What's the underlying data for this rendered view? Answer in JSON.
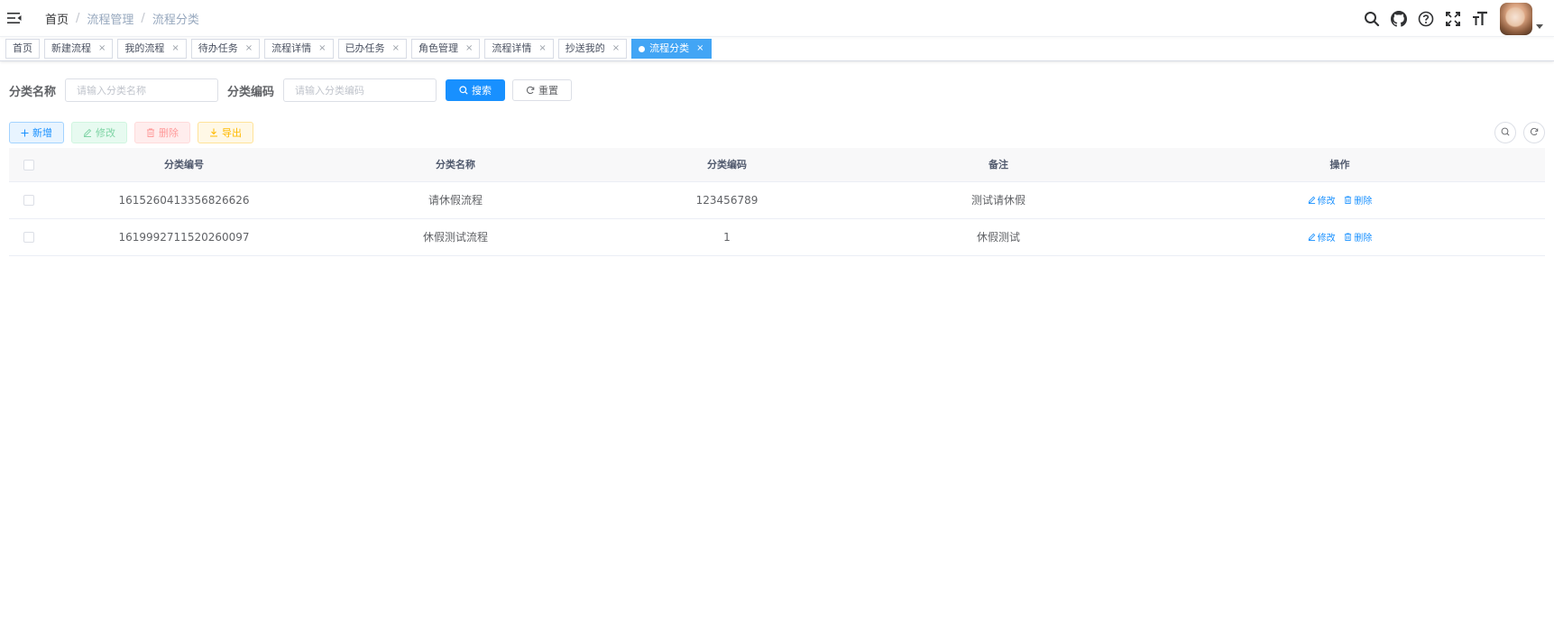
{
  "breadcrumb": [
    "首页",
    "流程管理",
    "流程分类"
  ],
  "tags": [
    {
      "label": "首页",
      "closable": false,
      "active": false
    },
    {
      "label": "新建流程",
      "closable": true,
      "active": false
    },
    {
      "label": "我的流程",
      "closable": true,
      "active": false
    },
    {
      "label": "待办任务",
      "closable": true,
      "active": false
    },
    {
      "label": "流程详情",
      "closable": true,
      "active": false
    },
    {
      "label": "已办任务",
      "closable": true,
      "active": false
    },
    {
      "label": "角色管理",
      "closable": true,
      "active": false
    },
    {
      "label": "流程详情",
      "closable": true,
      "active": false
    },
    {
      "label": "抄送我的",
      "closable": true,
      "active": false
    },
    {
      "label": "流程分类",
      "closable": true,
      "active": true
    }
  ],
  "search": {
    "name_label": "分类名称",
    "name_placeholder": "请输入分类名称",
    "code_label": "分类编码",
    "code_placeholder": "请输入分类编码",
    "search_btn": "搜索",
    "reset_btn": "重置"
  },
  "toolbar": {
    "add": "新增",
    "edit": "修改",
    "delete": "删除",
    "export": "导出"
  },
  "table": {
    "headers": [
      "分类编号",
      "分类名称",
      "分类编码",
      "备注",
      "操作"
    ],
    "rows": [
      {
        "id": "1615260413356826626",
        "name": "请休假流程",
        "code": "123456789",
        "remark": "测试请休假"
      },
      {
        "id": "1619992711520260097",
        "name": "休假测试流程",
        "code": "1",
        "remark": "休假测试"
      }
    ],
    "edit_link": "修改",
    "delete_link": "删除"
  },
  "colors": {
    "primary": "#1890ff",
    "active_tag": "#42a5f5"
  }
}
